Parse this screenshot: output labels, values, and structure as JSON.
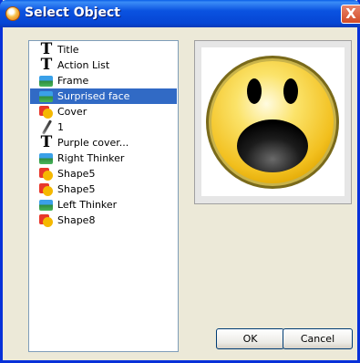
{
  "window": {
    "title": "Select Object",
    "close_label": "X"
  },
  "list": {
    "items": [
      {
        "label": "Title",
        "icon": "text-icon",
        "selected": false
      },
      {
        "label": "Action List",
        "icon": "text-icon",
        "selected": false
      },
      {
        "label": "Frame",
        "icon": "image-icon",
        "selected": false
      },
      {
        "label": "Surprised face",
        "icon": "image-icon",
        "selected": true
      },
      {
        "label": "Cover",
        "icon": "shape-icon",
        "selected": false
      },
      {
        "label": "1",
        "icon": "pen-icon",
        "selected": false
      },
      {
        "label": "Purple cover...",
        "icon": "text-icon",
        "selected": false
      },
      {
        "label": "Right Thinker",
        "icon": "image-icon",
        "selected": false
      },
      {
        "label": "Shape5",
        "icon": "shape-icon",
        "selected": false
      },
      {
        "label": "Shape5",
        "icon": "shape-icon",
        "selected": false
      },
      {
        "label": "Left Thinker",
        "icon": "image-icon",
        "selected": false
      },
      {
        "label": "Shape8",
        "icon": "shape-icon",
        "selected": false
      }
    ]
  },
  "preview": {
    "image": "surprised-face"
  },
  "buttons": {
    "ok": "OK",
    "cancel": "Cancel"
  },
  "colors": {
    "selection": "#316ac5",
    "titlebar": "#0a52e0"
  }
}
